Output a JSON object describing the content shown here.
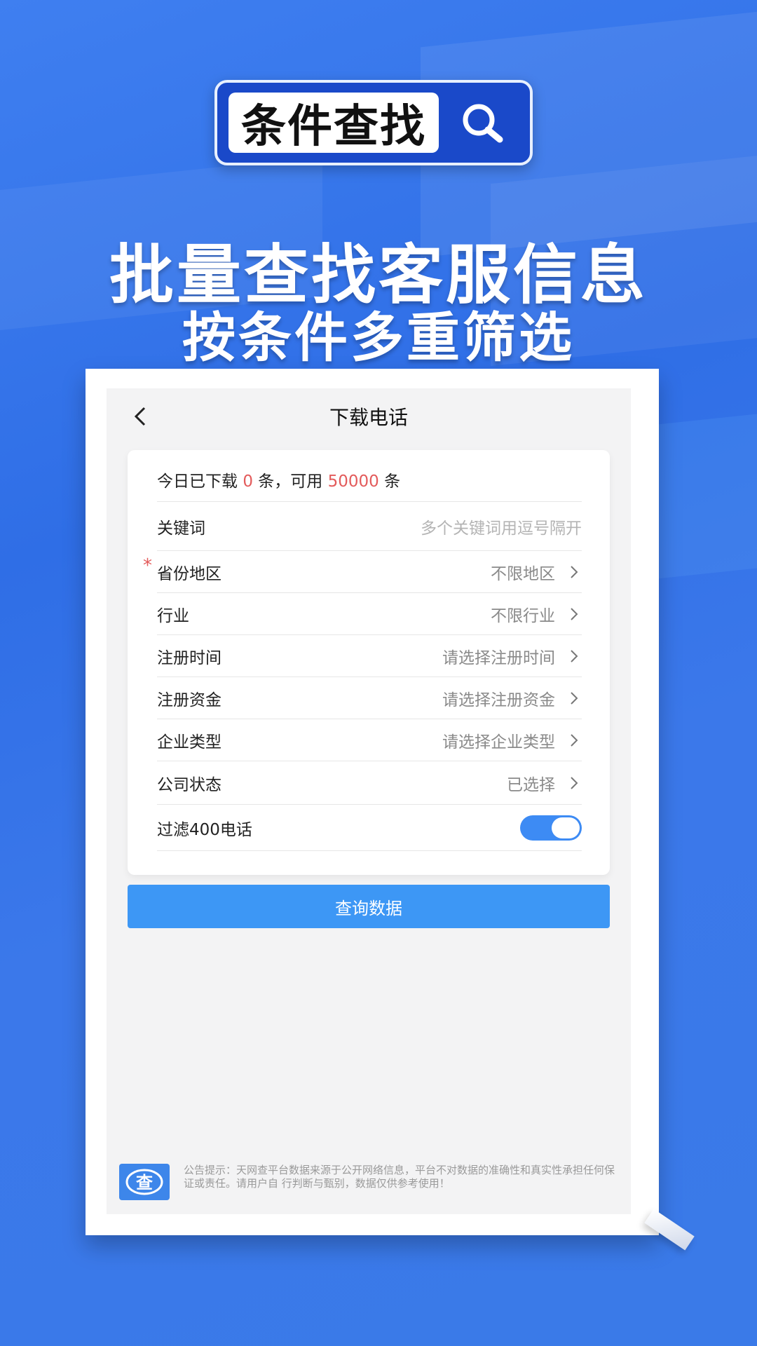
{
  "promo": {
    "badge_text": "条件查找",
    "headline_1": "批量查找客服信息",
    "headline_2": "按条件多重筛选"
  },
  "screen": {
    "title": "下载电话",
    "summary": {
      "prefix": "今日已下载",
      "downloaded": "0",
      "middle": "条，可用",
      "available": "50000",
      "suffix": "条"
    },
    "fields": [
      {
        "label": "关键词",
        "value": "多个关键词用逗号隔开"
      },
      {
        "label": "省份地区",
        "value": "不限地区",
        "required": "*"
      },
      {
        "label": "行业",
        "value": "不限行业"
      },
      {
        "label": "注册时间",
        "value": "请选择注册时间"
      },
      {
        "label": "注册资金",
        "value": "请选择注册资金"
      },
      {
        "label": "企业类型",
        "value": "请选择企业类型"
      },
      {
        "label": "公司状态",
        "value": "已选择"
      },
      {
        "label": "过滤400电话",
        "toggle_on": true
      }
    ],
    "query_button": "查询数据",
    "notice": "公告提示：天网查平台数据来源于公开网络信息，平台不对数据的准确性和真实性承担任何保证或责任。请用户自 行判断与甄别，数据仅供参考使用！",
    "notice_logo_char": "查"
  },
  "colors": {
    "background": "#3472e8",
    "accent_red": "#e35b5b",
    "button_blue": "#3d97f5",
    "toggle_blue": "#3d8bf4"
  }
}
